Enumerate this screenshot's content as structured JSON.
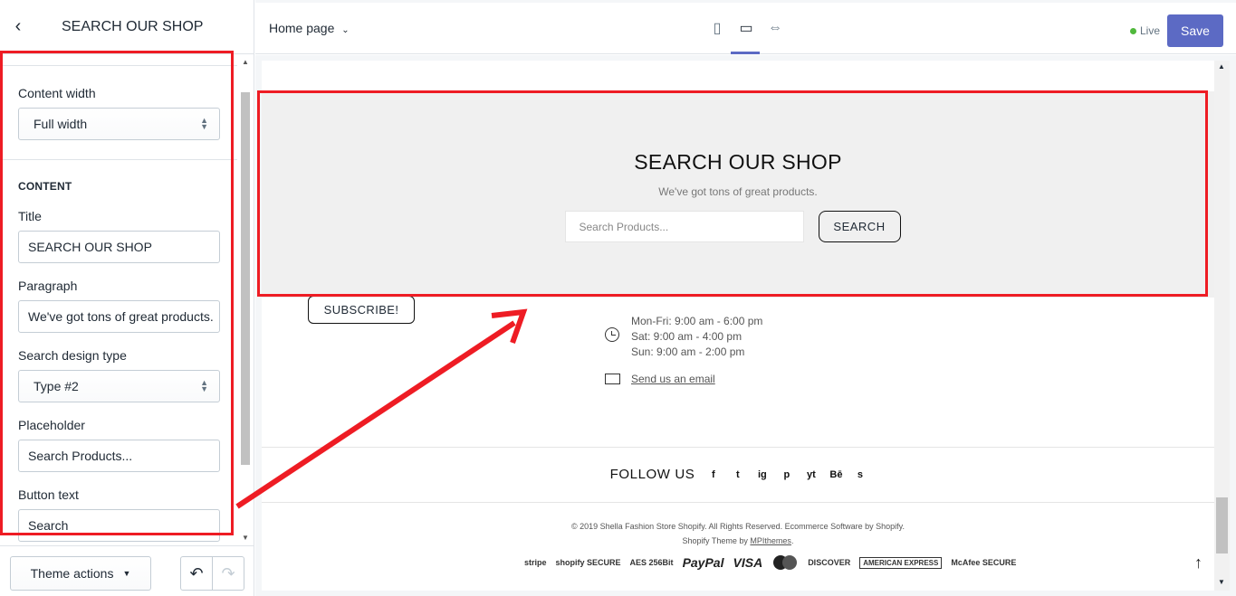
{
  "sidebar": {
    "title": "SEARCH OUR SHOP",
    "content_width_label": "Content width",
    "content_width_value": "Full width",
    "content_heading": "CONTENT",
    "title_label": "Title",
    "title_value": "SEARCH OUR SHOP",
    "paragraph_label": "Paragraph",
    "paragraph_value": "We've got tons of great products.",
    "design_type_label": "Search design type",
    "design_type_value": "Type #2",
    "placeholder_label": "Placeholder",
    "placeholder_value": "Search Products...",
    "button_text_label": "Button text",
    "button_text_value": "Search",
    "theme_actions": "Theme actions"
  },
  "topbar": {
    "page_select": "Home page",
    "live_label": "Live",
    "save_label": "Save"
  },
  "preview": {
    "search_title": "SEARCH OUR SHOP",
    "search_paragraph": "We've got tons of great products.",
    "search_placeholder": "Search Products...",
    "search_button": "SEARCH",
    "subscribe_button": "SUBSCRIBE!",
    "hours_line1": "Mon-Fri: 9:00 am - 6:00 pm",
    "hours_line2": "Sat: 9:00 am - 4:00 pm",
    "hours_line3": "Sun: 9:00 am - 2:00 pm",
    "email_link": "Send us an email",
    "follow_label": "FOLLOW US",
    "social": [
      "f",
      "t",
      "ig",
      "p",
      "yt",
      "Bē",
      "s"
    ],
    "copyright": "© 2019 Shella Fashion Store Shopify. All Rights Reserved. Ecommerce Software by Shopify.",
    "theme_by": "Shopify Theme by",
    "theme_link": "MPIthemes",
    "payments": [
      "stripe",
      "shopify SECURE",
      "AES 256Bit",
      "PayPal",
      "VISA",
      "DISCOVER",
      "AMERICAN EXPRESS",
      "McAfee SECURE"
    ]
  },
  "colors": {
    "accent": "#5c6ac4",
    "highlight": "#ee1c24",
    "live": "#50b83c"
  }
}
